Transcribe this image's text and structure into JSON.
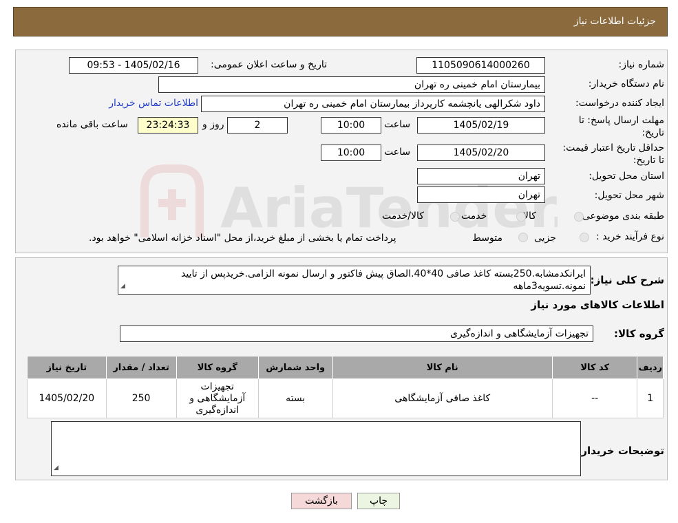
{
  "header": {
    "title": "جزئيات اطلاعات نياز"
  },
  "watermark": {
    "text": "AriaTender.neT"
  },
  "need_number": {
    "label": "شماره نیاز:",
    "value": "1105090614000260"
  },
  "announce_datetime": {
    "label": "تاریخ و ساعت اعلان عمومی:",
    "value": "1405/02/16 - 09:53"
  },
  "buyer_org": {
    "label": "نام دستگاه خریدار:",
    "value": "بیمارستان امام خمینی ره  تهران"
  },
  "requester": {
    "label": "ایجاد کننده درخواست:",
    "value": "داود شکرالهی یانچشمه کارپرداز بیمارستان امام خمینی ره  تهران",
    "contact_link": "اطلاعات تماس خریدار"
  },
  "response_deadline": {
    "label": "مهلت ارسال پاسخ: تا تاریخ:",
    "date": "1405/02/19",
    "time_label": "ساعت",
    "time": "10:00",
    "days": "2",
    "days_label": "روز و",
    "remaining": "23:24:33",
    "remaining_label": "ساعت باقی مانده"
  },
  "price_validity": {
    "label": "حداقل تاریخ اعتبار قیمت: تا تاریخ:",
    "date": "1405/02/20",
    "time_label": "ساعت",
    "time": "10:00"
  },
  "province": {
    "label": "استان محل تحویل:",
    "value": "تهران"
  },
  "city": {
    "label": "شهر محل تحویل:",
    "value": "تهران"
  },
  "category": {
    "label": "طبقه بندی موضوعی:",
    "options": [
      "کالا",
      "خدمت",
      "کالا/خدمت"
    ]
  },
  "purchase_type": {
    "label": "نوع فرآیند خرید :",
    "options": [
      "جزیی",
      "متوسط"
    ],
    "note": "پرداخت تمام یا بخشی از مبلغ خرید،از محل \"اسناد خزانه اسلامی\" خواهد بود."
  },
  "description": {
    "label": "شرح کلی نیاز:",
    "value": "ایرانکدمشابه.250بسته کاغذ صافی 40*40.الصاق پیش فاکتور و ارسال نمونه الزامی.خریدپس از تایید نمونه.تسویه3ماهه"
  },
  "items_section": {
    "title": "اطلاعات کالاهای مورد نیاز"
  },
  "goods_group": {
    "label": "گروه کالا:",
    "value": "تجهیزات آزمایشگاهی و اندازه‌گیری"
  },
  "table": {
    "headers": [
      "ردیف",
      "کد کالا",
      "نام کالا",
      "واحد شمارش",
      "گروه کالا",
      "تعداد / مقدار",
      "تاریخ نیاز"
    ],
    "rows": [
      [
        "1",
        "--",
        "کاغذ صافی آزمایشگاهی",
        "بسته",
        "تجهیزات آزمایشگاهی و اندازه‌گیری",
        "250",
        "1405/02/20"
      ]
    ]
  },
  "buyer_notes": {
    "label": "توضیحات خریدار:",
    "value": ""
  },
  "buttons": {
    "print": "چاپ",
    "back": "بازگشت"
  }
}
